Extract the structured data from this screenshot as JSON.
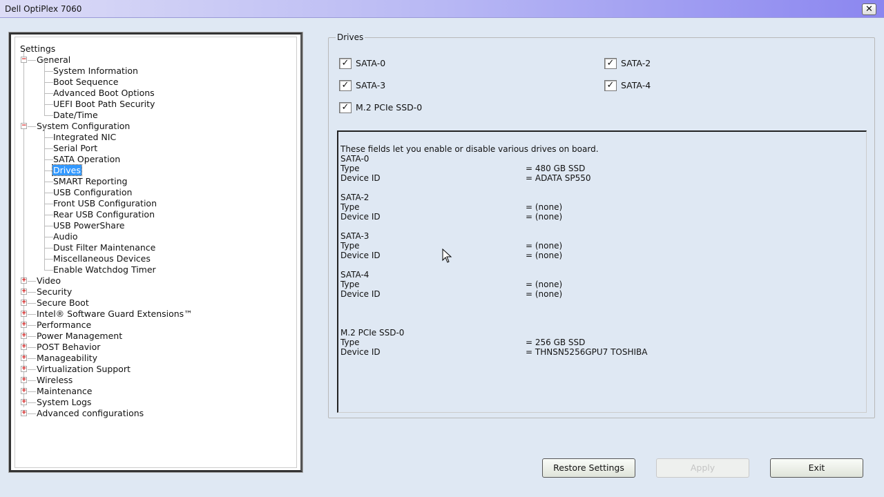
{
  "window": {
    "title": "Dell OptiPlex 7060",
    "close_label": "✕"
  },
  "tree": [
    {
      "label": "Settings",
      "level": 0
    },
    {
      "label": "General",
      "level": 1,
      "expander": "-"
    },
    {
      "label": "System Information",
      "level": 2
    },
    {
      "label": "Boot Sequence",
      "level": 2
    },
    {
      "label": "Advanced Boot Options",
      "level": 2
    },
    {
      "label": "UEFI Boot Path Security",
      "level": 2
    },
    {
      "label": "Date/Time",
      "level": 2
    },
    {
      "label": "System Configuration",
      "level": 1,
      "expander": "-"
    },
    {
      "label": "Integrated NIC",
      "level": 2
    },
    {
      "label": "Serial Port",
      "level": 2
    },
    {
      "label": "SATA Operation",
      "level": 2
    },
    {
      "label": "Drives",
      "level": 2,
      "selected": true
    },
    {
      "label": "SMART Reporting",
      "level": 2
    },
    {
      "label": "USB Configuration",
      "level": 2
    },
    {
      "label": "Front USB Configuration",
      "level": 2
    },
    {
      "label": "Rear USB Configuration",
      "level": 2
    },
    {
      "label": "USB PowerShare",
      "level": 2
    },
    {
      "label": "Audio",
      "level": 2
    },
    {
      "label": "Dust Filter Maintenance",
      "level": 2
    },
    {
      "label": "Miscellaneous Devices",
      "level": 2
    },
    {
      "label": "Enable Watchdog Timer",
      "level": 2
    },
    {
      "label": "Video",
      "level": 1,
      "expander": "+"
    },
    {
      "label": "Security",
      "level": 1,
      "expander": "+"
    },
    {
      "label": "Secure Boot",
      "level": 1,
      "expander": "+"
    },
    {
      "label": "Intel® Software Guard Extensions™",
      "level": 1,
      "expander": "+"
    },
    {
      "label": "Performance",
      "level": 1,
      "expander": "+"
    },
    {
      "label": "Power Management",
      "level": 1,
      "expander": "+"
    },
    {
      "label": "POST Behavior",
      "level": 1,
      "expander": "+"
    },
    {
      "label": "Manageability",
      "level": 1,
      "expander": "+"
    },
    {
      "label": "Virtualization Support",
      "level": 1,
      "expander": "+"
    },
    {
      "label": "Wireless",
      "level": 1,
      "expander": "+"
    },
    {
      "label": "Maintenance",
      "level": 1,
      "expander": "+"
    },
    {
      "label": "System Logs",
      "level": 1,
      "expander": "+"
    },
    {
      "label": "Advanced configurations",
      "level": 1,
      "expander": "+"
    }
  ],
  "drives": {
    "group_title": "Drives",
    "checkboxes": [
      {
        "label": "SATA-0",
        "checked": true
      },
      {
        "label": "SATA-2",
        "checked": true
      },
      {
        "label": "SATA-3",
        "checked": true
      },
      {
        "label": "SATA-4",
        "checked": true
      },
      {
        "label": "M.2 PCIe SSD-0",
        "checked": true
      }
    ],
    "check_mark": "✓",
    "details": [
      {
        "label": "These fields let you enable or disable various drives on board.",
        "value": ""
      },
      {
        "label": "SATA-0",
        "value": ""
      },
      {
        "label": "Type",
        "value": "= 480 GB SSD"
      },
      {
        "label": "Device ID",
        "value": "= ADATA SP550"
      },
      {
        "label": "",
        "value": ""
      },
      {
        "label": "SATA-2",
        "value": ""
      },
      {
        "label": "Type",
        "value": "= (none)"
      },
      {
        "label": "Device ID",
        "value": "= (none)"
      },
      {
        "label": "",
        "value": ""
      },
      {
        "label": "SATA-3",
        "value": ""
      },
      {
        "label": "Type",
        "value": "= (none)"
      },
      {
        "label": "Device ID",
        "value": "= (none)"
      },
      {
        "label": "",
        "value": ""
      },
      {
        "label": "SATA-4",
        "value": ""
      },
      {
        "label": "Type",
        "value": "= (none)"
      },
      {
        "label": "Device ID",
        "value": "= (none)"
      },
      {
        "label": "",
        "value": ""
      },
      {
        "label": "",
        "value": ""
      },
      {
        "label": "",
        "value": ""
      },
      {
        "label": "M.2 PCIe SSD-0",
        "value": ""
      },
      {
        "label": "Type",
        "value": "= 256 GB SSD"
      },
      {
        "label": "Device ID",
        "value": "= THNSN5256GPU7 TOSHIBA"
      }
    ]
  },
  "buttons": {
    "restore": "Restore Settings",
    "apply": "Apply",
    "exit": "Exit"
  }
}
